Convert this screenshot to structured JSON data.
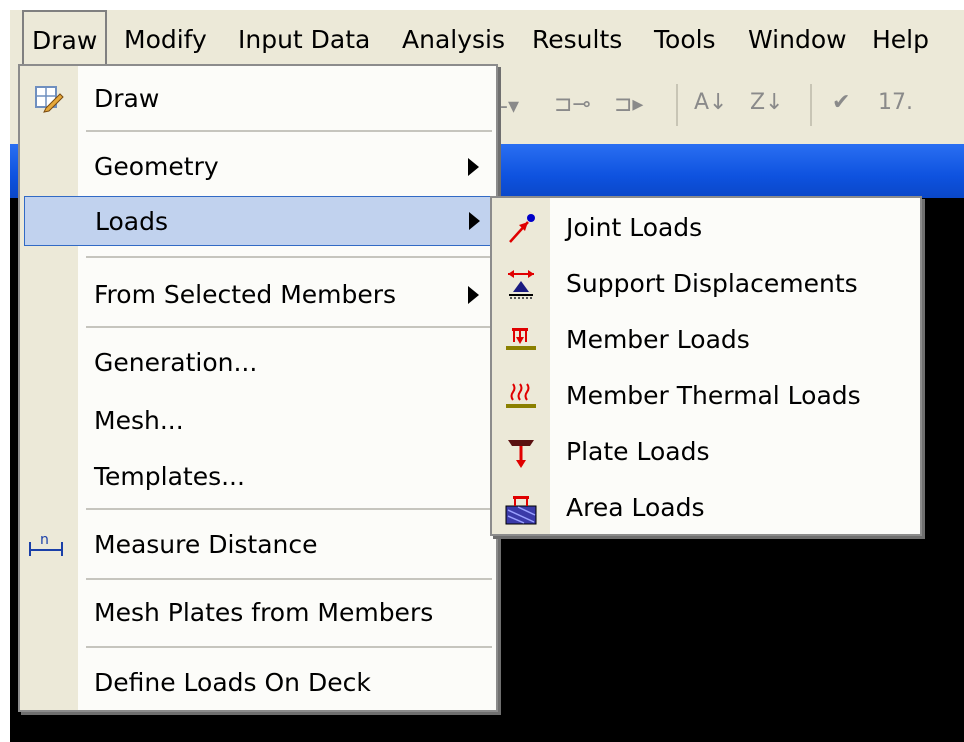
{
  "menubar": {
    "items": [
      {
        "label": "Draw",
        "active": true
      },
      {
        "label": "Modify"
      },
      {
        "label": "Input Data"
      },
      {
        "label": "Analysis"
      },
      {
        "label": "Results"
      },
      {
        "label": "Tools"
      },
      {
        "label": "Window"
      },
      {
        "label": "Help"
      }
    ]
  },
  "toolbar": {
    "number_text": "17."
  },
  "draw_menu": {
    "items": [
      {
        "label": "Draw",
        "icon": "draw-pencil-icon"
      },
      {
        "label": "Geometry",
        "submenu": true
      },
      {
        "label": "Loads",
        "submenu": true,
        "highlighted": true
      },
      {
        "label": "From Selected Members",
        "submenu": true
      },
      {
        "label": "Generation..."
      },
      {
        "label": "Mesh..."
      },
      {
        "label": "Templates..."
      },
      {
        "label": "Measure Distance",
        "icon": "measure-distance-icon"
      },
      {
        "label": "Mesh Plates from Members"
      },
      {
        "label": "Define Loads On Deck"
      }
    ]
  },
  "loads_submenu": {
    "items": [
      {
        "label": "Joint Loads",
        "icon": "joint-load-icon"
      },
      {
        "label": "Support Displacements",
        "icon": "support-displacement-icon"
      },
      {
        "label": "Member Loads",
        "icon": "member-load-icon"
      },
      {
        "label": "Member Thermal Loads",
        "icon": "thermal-load-icon"
      },
      {
        "label": "Plate Loads",
        "icon": "plate-load-icon"
      },
      {
        "label": "Area Loads",
        "icon": "area-load-icon"
      }
    ]
  },
  "colors": {
    "menu_bg": "#ece9d8",
    "highlight_bg": "#c1d2ee",
    "highlight_border": "#316ac5",
    "titlebar_blue": "#0e52df",
    "workspace": "#000000"
  }
}
